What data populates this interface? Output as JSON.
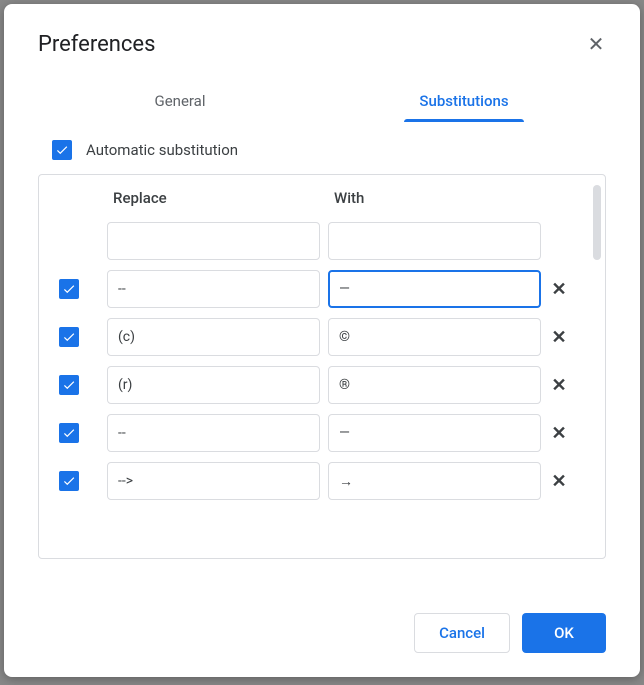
{
  "dialog": {
    "title": "Preferences",
    "tabs": {
      "general": "General",
      "substitutions": "Substitutions"
    },
    "auto_sub_label": "Automatic substitution",
    "columns": {
      "replace": "Replace",
      "with": "With"
    },
    "rows": [
      {
        "enabled": false,
        "replace": "",
        "with": "",
        "deletable": false,
        "focused": false,
        "blank": true
      },
      {
        "enabled": true,
        "replace": "--",
        "with": "—",
        "deletable": true,
        "focused": true
      },
      {
        "enabled": true,
        "replace": "(c)",
        "with": "©",
        "deletable": true,
        "focused": false
      },
      {
        "enabled": true,
        "replace": "(r)",
        "with": "®",
        "deletable": true,
        "focused": false
      },
      {
        "enabled": true,
        "replace": "--",
        "with": "—",
        "deletable": true,
        "focused": false
      },
      {
        "enabled": true,
        "replace": "-->",
        "with": "→",
        "deletable": true,
        "focused": false
      }
    ],
    "footer": {
      "cancel": "Cancel",
      "ok": "OK"
    }
  }
}
